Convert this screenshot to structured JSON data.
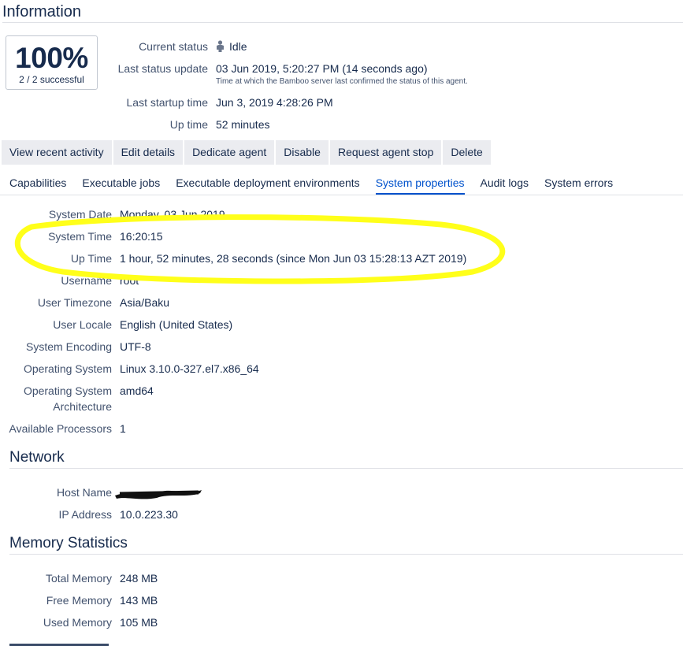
{
  "information": {
    "heading": "Information",
    "success_rate": "100%",
    "success_count": "2 / 2 successful",
    "current_status_label": "Current status",
    "current_status_value": "Idle",
    "current_status_icon": "agent-idle-icon",
    "last_status_update_label": "Last status update",
    "last_status_update_value": "03 Jun 2019, 5:20:27 PM (14 seconds ago)",
    "last_status_update_note": "Time at which the Bamboo server last confirmed the status of this agent.",
    "last_startup_label": "Last startup time",
    "last_startup_value": "Jun 3, 2019 4:28:26 PM",
    "up_time_label": "Up time",
    "up_time_value": "52 minutes"
  },
  "actions": [
    "View recent activity",
    "Edit details",
    "Dedicate agent",
    "Disable",
    "Request agent stop",
    "Delete"
  ],
  "tabs": [
    {
      "label": "Capabilities",
      "active": false
    },
    {
      "label": "Executable jobs",
      "active": false
    },
    {
      "label": "Executable deployment environments",
      "active": false
    },
    {
      "label": "System properties",
      "active": true
    },
    {
      "label": "Audit logs",
      "active": false
    },
    {
      "label": "System errors",
      "active": false
    }
  ],
  "system_properties": [
    {
      "label": "System Date",
      "value": "Monday, 03 Jun 2019"
    },
    {
      "label": "System Time",
      "value": "16:20:15"
    },
    {
      "label": "Up Time",
      "value": "1 hour, 52 minutes, 28 seconds (since Mon Jun 03 15:28:13 AZT 2019)"
    },
    {
      "label": "Username",
      "value": "root"
    },
    {
      "label": "User Timezone",
      "value": "Asia/Baku"
    },
    {
      "label": "User Locale",
      "value": "English (United States)"
    },
    {
      "label": "System Encoding",
      "value": "UTF-8"
    },
    {
      "label": "Operating System",
      "value": "Linux 3.10.0-327.el7.x86_64"
    },
    {
      "label_line1": "Operating System",
      "label_line2": "Architecture",
      "value": "amd64"
    },
    {
      "label": "Available Processors",
      "value": "1"
    }
  ],
  "network": {
    "heading": "Network",
    "host_name_label": "Host Name",
    "ip_address_label": "IP Address",
    "ip_address_value": "10.0.223.30"
  },
  "memory": {
    "heading": "Memory Statistics",
    "total_label": "Total Memory",
    "total_value": "248 MB",
    "free_label": "Free Memory",
    "free_value": "143 MB",
    "used_label": "Used Memory",
    "used_value": "105 MB"
  },
  "colors": {
    "highlight": "#ffff1a",
    "active_tab": "#0052cc",
    "button_bg": "#ebecf0"
  }
}
